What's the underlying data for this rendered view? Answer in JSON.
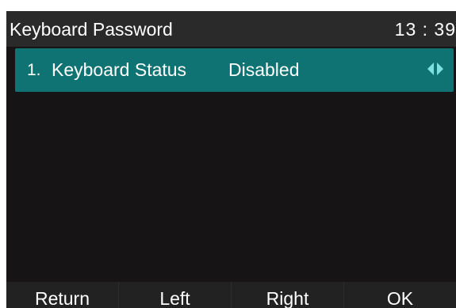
{
  "header": {
    "title": "Keyboard Password",
    "time": "13 : 39"
  },
  "menu": {
    "items": [
      {
        "index": "1.",
        "label": "Keyboard Status",
        "value": "Disabled"
      }
    ]
  },
  "softkeys": {
    "return_label": "Return",
    "left_label": "Left",
    "right_label": "Right",
    "ok_label": "OK"
  },
  "colors": {
    "screen_background": "#161414",
    "header_background": "#2a2a2a",
    "selected_item": "#0f7373",
    "arrow_accent": "#7ee1e1",
    "text": "#ffffff"
  },
  "icons": [
    "arrow-left-icon",
    "arrow-right-icon"
  ]
}
